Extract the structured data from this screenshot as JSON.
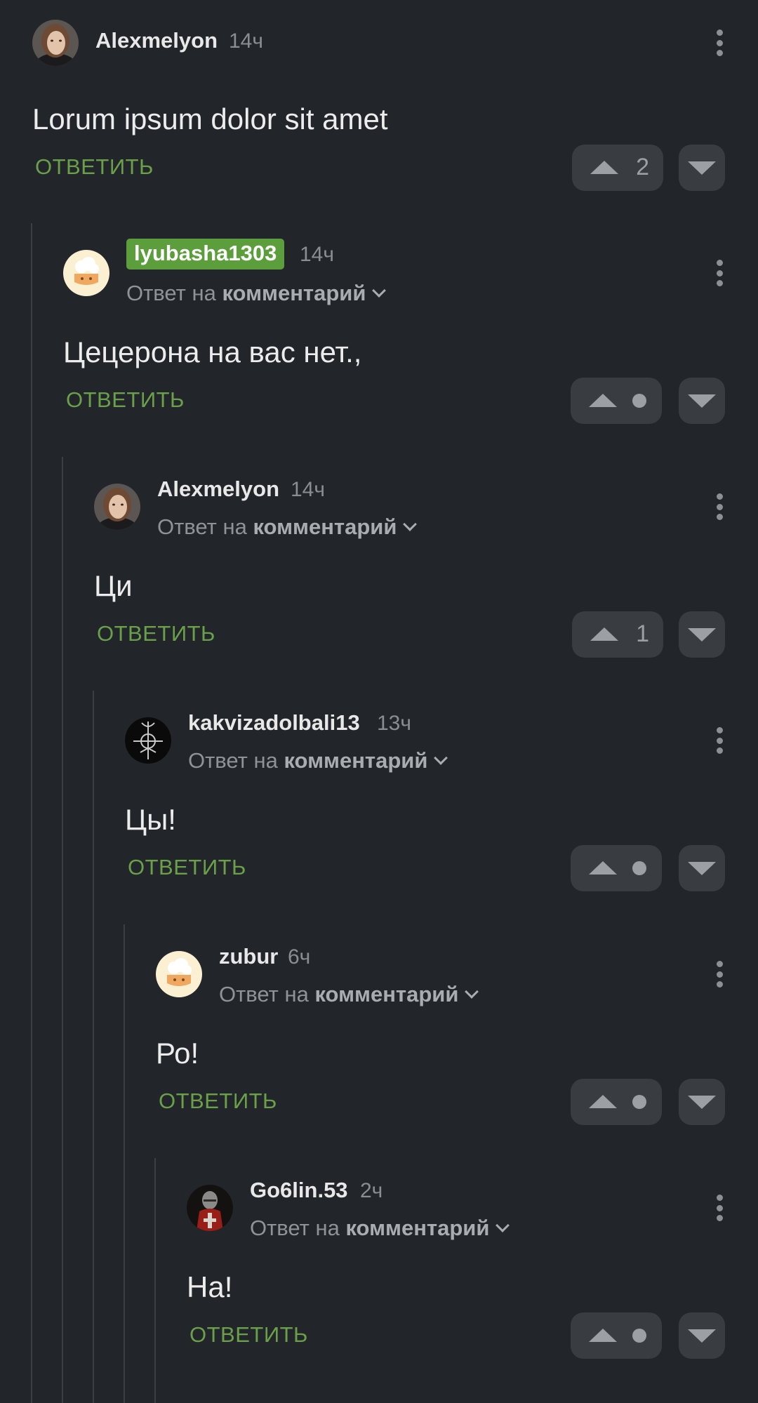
{
  "reply_prefix": "Ответ на",
  "reply_target": "комментарий",
  "reply_button_label": "ОТВЕТИТЬ",
  "accent_color": "#6aa04a",
  "highlight_color": "#5c9e3c",
  "comments": [
    {
      "username": "Alexmelyon",
      "time": "14ч",
      "text": "Lorum ipsum dolor sit amet",
      "rating": "2",
      "avatar": "woman-photo-avatar",
      "is_reply": false,
      "highlighted": false
    },
    {
      "username": "lyubasha1303",
      "time": "14ч",
      "text": "Цецерона на вас нет.,",
      "rating": null,
      "avatar": "cloud-avatar",
      "is_reply": true,
      "highlighted": true
    },
    {
      "username": "Alexmelyon",
      "time": "14ч",
      "text": "Ци",
      "rating": "1",
      "avatar": "woman-photo-avatar",
      "is_reply": true,
      "highlighted": false
    },
    {
      "username": "kakvizadolbali13",
      "time": "13ч",
      "text": "Цы!",
      "rating": null,
      "avatar": "symbol-avatar",
      "is_reply": true,
      "highlighted": false
    },
    {
      "username": "zubur",
      "time": "6ч",
      "text": "Ро!",
      "rating": null,
      "avatar": "cloud-avatar",
      "is_reply": true,
      "highlighted": false
    },
    {
      "username": "Go6lin.53",
      "time": "2ч",
      "text": "На!",
      "rating": null,
      "avatar": "knight-avatar",
      "is_reply": true,
      "highlighted": false
    }
  ]
}
